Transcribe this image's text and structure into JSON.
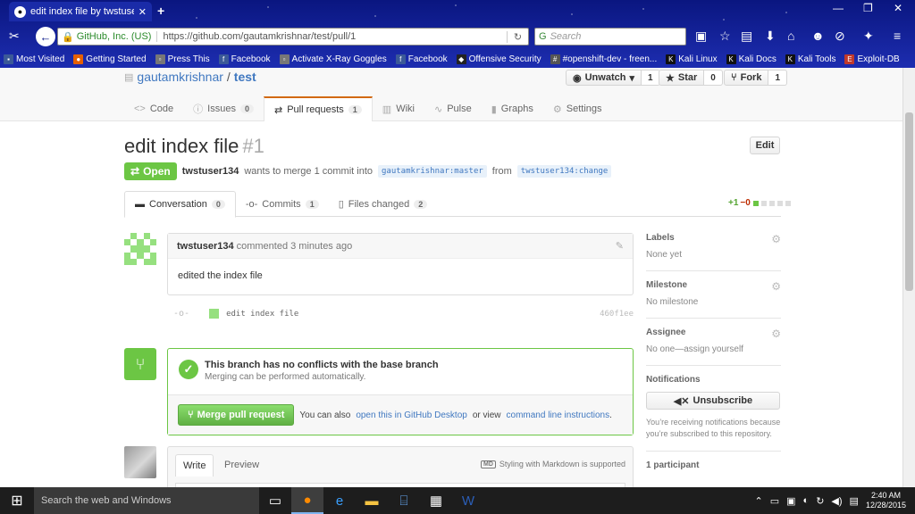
{
  "browser": {
    "tab_title": "edit index file by twstuser1...",
    "identity": "GitHub, Inc. (US)",
    "url": "https://github.com/gautamkrishnar/test/pull/1",
    "search_placeholder": "Search",
    "bookmarks": [
      "Most Visited",
      "Getting Started",
      "Press This",
      "Facebook",
      "Activate X-Ray Goggles",
      "Facebook",
      "Offensive Security",
      "#openshift-dev - freen...",
      "Kali Linux",
      "Kali Docs",
      "Kali Tools",
      "Exploit-DB"
    ]
  },
  "repo": {
    "owner": "gautamkrishnar",
    "separator": "/",
    "name": "test",
    "unwatch_label": "Unwatch",
    "unwatch_count": "1",
    "star_label": "Star",
    "star_count": "0",
    "fork_label": "Fork",
    "fork_count": "1",
    "nav": [
      {
        "label": "Code",
        "count": ""
      },
      {
        "label": "Issues",
        "count": "0"
      },
      {
        "label": "Pull requests",
        "count": "1"
      },
      {
        "label": "Wiki",
        "count": ""
      },
      {
        "label": "Pulse",
        "count": ""
      },
      {
        "label": "Graphs",
        "count": ""
      },
      {
        "label": "Settings",
        "count": ""
      }
    ]
  },
  "pr": {
    "title": "edit index file",
    "number": "#1",
    "edit_label": "Edit",
    "state": "Open",
    "author": "twstuser134",
    "meta_text": "wants to merge 1 commit into",
    "base_ref": "gautamkrishnar:master",
    "from_text": "from",
    "head_ref": "twstuser134:change",
    "tabs": [
      {
        "label": "Conversation",
        "count": "0"
      },
      {
        "label": "Commits",
        "count": "1"
      },
      {
        "label": "Files changed",
        "count": "2"
      }
    ],
    "additions": "+1",
    "deletions": "−0"
  },
  "comment": {
    "author": "twstuser134",
    "time_text": "commented 3 minutes ago",
    "body": "edited the index file"
  },
  "commit": {
    "message": "edit index file",
    "sha": "460f1ee"
  },
  "merge": {
    "heading": "This branch has no conflicts with the base branch",
    "subtext": "Merging can be performed automatically.",
    "button_label": "Merge pull request",
    "also_text": "You can also",
    "desktop_link": "open this in GitHub Desktop",
    "or_text": "or view",
    "cli_link": "command line instructions",
    "period": "."
  },
  "compose": {
    "write_tab": "Write",
    "preview_tab": "Preview",
    "markdown_note": "Styling with Markdown is supported",
    "md_badge": "MD"
  },
  "sidebar": {
    "labels_title": "Labels",
    "labels_value": "None yet",
    "milestone_title": "Milestone",
    "milestone_value": "No milestone",
    "assignee_title": "Assignee",
    "assignee_value": "No one—assign yourself",
    "notifications_title": "Notifications",
    "unsubscribe_label": "Unsubscribe",
    "notifications_note": "You’re receiving notifications because you’re subscribed to this repository.",
    "participants": "1 participant"
  },
  "taskbar": {
    "search_placeholder": "Search the web and Windows",
    "time": "2:40 AM",
    "date": "12/28/2015"
  }
}
